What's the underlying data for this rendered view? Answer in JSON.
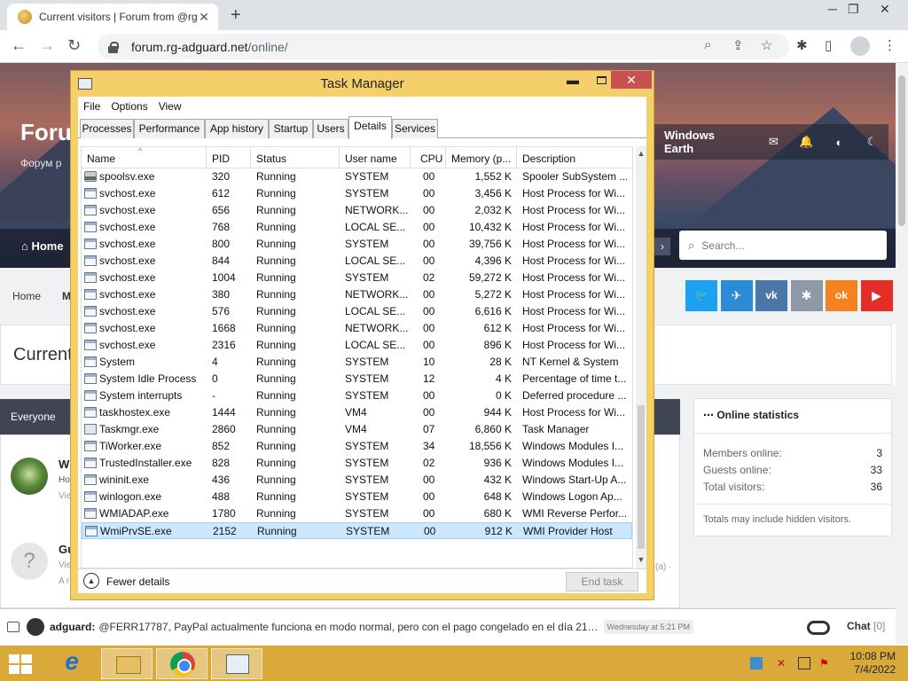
{
  "browser": {
    "tab_title": "Current visitors | Forum from @rg",
    "url_host": "forum.rg-adguard.net",
    "url_path": "/online/"
  },
  "forum": {
    "title": "Foru",
    "subtitle": "Форум р",
    "nav_label": "Windows Earth",
    "home": "Home",
    "search_placeholder": "Search...",
    "breadcrumb_home": "Home",
    "breadcrumb_next": "M",
    "page_title": "Current",
    "everyone_tab": "Everyone",
    "social": [
      "t",
      "tg",
      "vk",
      "*",
      "ok",
      "yt"
    ],
    "social_colors": [
      "#1da1f2",
      "#2b8bd6",
      "#4a76a8",
      "#8e99a8",
      "#f58220",
      "#e52d27"
    ],
    "user1_frag": [
      "W",
      "Ho",
      "Vie"
    ],
    "user2_frag": [
      "Gu",
      "Vie",
      "A r"
    ],
    "user2_avatar": "?",
    "trailing_frag": "(a) ·"
  },
  "stats": {
    "heading": "Online statistics",
    "rows": [
      {
        "label": "Members online:",
        "value": "3"
      },
      {
        "label": "Guests online:",
        "value": "33"
      },
      {
        "label": "Total visitors:",
        "value": "36"
      }
    ],
    "footnote": "Totals may include hidden visitors."
  },
  "chat": {
    "user": "adguard:",
    "message": "@FERR17787, PayPal actualmente funciona en modo normal, pero con el pago congelado en el día 21…",
    "time": "Wednesday at 5:21 PM",
    "label": "Chat",
    "count": "[0]"
  },
  "taskmanager": {
    "title": "Task Manager",
    "menu": [
      "File",
      "Options",
      "View"
    ],
    "tabs": [
      "Processes",
      "Performance",
      "App history",
      "Startup",
      "Users",
      "Details",
      "Services"
    ],
    "active_tab": "Details",
    "columns": {
      "name": "Name",
      "pid": "PID",
      "status": "Status",
      "user": "User name",
      "cpu": "CPU",
      "mem": "Memory (p...",
      "desc": "Description"
    },
    "sort_glyph": "^",
    "rows": [
      {
        "name": "spoolsv.exe",
        "pid": "320",
        "status": "Running",
        "user": "SYSTEM",
        "cpu": "00",
        "mem": "1,552 K",
        "desc": "Spooler SubSystem ...",
        "icon": "printer"
      },
      {
        "name": "svchost.exe",
        "pid": "612",
        "status": "Running",
        "user": "SYSTEM",
        "cpu": "00",
        "mem": "3,456 K",
        "desc": "Host Process for Wi...",
        "icon": "window"
      },
      {
        "name": "svchost.exe",
        "pid": "656",
        "status": "Running",
        "user": "NETWORK...",
        "cpu": "00",
        "mem": "2,032 K",
        "desc": "Host Process for Wi...",
        "icon": "window"
      },
      {
        "name": "svchost.exe",
        "pid": "768",
        "status": "Running",
        "user": "LOCAL SE...",
        "cpu": "00",
        "mem": "10,432 K",
        "desc": "Host Process for Wi...",
        "icon": "window"
      },
      {
        "name": "svchost.exe",
        "pid": "800",
        "status": "Running",
        "user": "SYSTEM",
        "cpu": "00",
        "mem": "39,756 K",
        "desc": "Host Process for Wi...",
        "icon": "window"
      },
      {
        "name": "svchost.exe",
        "pid": "844",
        "status": "Running",
        "user": "LOCAL SE...",
        "cpu": "00",
        "mem": "4,396 K",
        "desc": "Host Process for Wi...",
        "icon": "window"
      },
      {
        "name": "svchost.exe",
        "pid": "1004",
        "status": "Running",
        "user": "SYSTEM",
        "cpu": "02",
        "mem": "59,272 K",
        "desc": "Host Process for Wi...",
        "icon": "window"
      },
      {
        "name": "svchost.exe",
        "pid": "380",
        "status": "Running",
        "user": "NETWORK...",
        "cpu": "00",
        "mem": "5,272 K",
        "desc": "Host Process for Wi...",
        "icon": "window"
      },
      {
        "name": "svchost.exe",
        "pid": "576",
        "status": "Running",
        "user": "LOCAL SE...",
        "cpu": "00",
        "mem": "6,616 K",
        "desc": "Host Process for Wi...",
        "icon": "window"
      },
      {
        "name": "svchost.exe",
        "pid": "1668",
        "status": "Running",
        "user": "NETWORK...",
        "cpu": "00",
        "mem": "612 K",
        "desc": "Host Process for Wi...",
        "icon": "window"
      },
      {
        "name": "svchost.exe",
        "pid": "2316",
        "status": "Running",
        "user": "LOCAL SE...",
        "cpu": "00",
        "mem": "896 K",
        "desc": "Host Process for Wi...",
        "icon": "window"
      },
      {
        "name": "System",
        "pid": "4",
        "status": "Running",
        "user": "SYSTEM",
        "cpu": "10",
        "mem": "28 K",
        "desc": "NT Kernel & System",
        "icon": "window"
      },
      {
        "name": "System Idle Process",
        "pid": "0",
        "status": "Running",
        "user": "SYSTEM",
        "cpu": "12",
        "mem": "4 K",
        "desc": "Percentage of time t...",
        "icon": "window"
      },
      {
        "name": "System interrupts",
        "pid": "-",
        "status": "Running",
        "user": "SYSTEM",
        "cpu": "00",
        "mem": "0 K",
        "desc": "Deferred procedure ...",
        "icon": "window"
      },
      {
        "name": "taskhostex.exe",
        "pid": "1444",
        "status": "Running",
        "user": "VM4",
        "cpu": "00",
        "mem": "944 K",
        "desc": "Host Process for Wi...",
        "icon": "window"
      },
      {
        "name": "Taskmgr.exe",
        "pid": "2860",
        "status": "Running",
        "user": "VM4",
        "cpu": "07",
        "mem": "6,860 K",
        "desc": "Task Manager",
        "icon": "taskmgr"
      },
      {
        "name": "TiWorker.exe",
        "pid": "852",
        "status": "Running",
        "user": "SYSTEM",
        "cpu": "34",
        "mem": "18,556 K",
        "desc": "Windows Modules I...",
        "icon": "window"
      },
      {
        "name": "TrustedInstaller.exe",
        "pid": "828",
        "status": "Running",
        "user": "SYSTEM",
        "cpu": "02",
        "mem": "936 K",
        "desc": "Windows Modules I...",
        "icon": "window"
      },
      {
        "name": "wininit.exe",
        "pid": "436",
        "status": "Running",
        "user": "SYSTEM",
        "cpu": "00",
        "mem": "432 K",
        "desc": "Windows Start-Up A...",
        "icon": "window"
      },
      {
        "name": "winlogon.exe",
        "pid": "488",
        "status": "Running",
        "user": "SYSTEM",
        "cpu": "00",
        "mem": "648 K",
        "desc": "Windows Logon Ap...",
        "icon": "window"
      },
      {
        "name": "WMIADAP.exe",
        "pid": "1780",
        "status": "Running",
        "user": "SYSTEM",
        "cpu": "00",
        "mem": "680 K",
        "desc": "WMI Reverse Perfor...",
        "icon": "window"
      },
      {
        "name": "WmiPrvSE.exe",
        "pid": "2152",
        "status": "Running",
        "user": "SYSTEM",
        "cpu": "00",
        "mem": "912 K",
        "desc": "WMI Provider Host",
        "icon": "window",
        "selected": true
      }
    ],
    "fewer_details": "Fewer details",
    "end_task": "End task"
  },
  "taskbar": {
    "time": "10:08 PM",
    "date": "7/4/2022"
  },
  "colors": {
    "taskbar": "#d9a93b",
    "tm_frame": "#f5cf6a",
    "close": "#c75050",
    "selection": "#cce8ff"
  }
}
